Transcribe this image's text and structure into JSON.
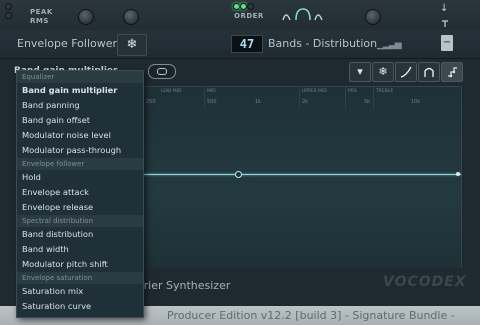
{
  "top": {
    "peak_label": "PEAK",
    "rms_label": "RMS",
    "order_label": "ORDER"
  },
  "panel": {
    "left_title": "Envelope Follower",
    "bands_value": "47",
    "right_title": "Bands - Distribution"
  },
  "graph": {
    "band_labels": [
      "LOW MID",
      "MID",
      "UPPER MID",
      "PRS",
      "TREBLE"
    ],
    "freq_labels": [
      "250",
      "500",
      "1k",
      "2k",
      "5k",
      "10k"
    ]
  },
  "menu": {
    "sections": [
      {
        "header": "Equalizer",
        "items": [
          "Band gain multiplier",
          "Band panning",
          "Band gain offset",
          "Modulator noise level",
          "Modulator pass-through"
        ]
      },
      {
        "header": "Envelope follower",
        "items": [
          "Hold",
          "Envelope attack",
          "Envelope release"
        ]
      },
      {
        "header": "Spectral distribution",
        "items": [
          "Band distribution",
          "Band width",
          "Modulator pitch shift"
        ]
      },
      {
        "header": "Envelope saturation",
        "items": [
          "Saturation mix",
          "Saturation curve"
        ]
      }
    ]
  },
  "bottom": {
    "synth_title": "Fourier Synthesizer",
    "logo": "VOCODEX",
    "status": "Producer Edition v12.2 [build 3] - Signature Bundle -"
  },
  "icons": {
    "freeze": "snowflake-icon",
    "envelope": "envelope-shape-icon",
    "filter": "filter-curve-icon",
    "bars": "bars-icon"
  },
  "colors": {
    "background": "#1e2a30",
    "envelope_line": "#8fd7dc",
    "lcd_text": "#a9dff2",
    "led_on": "#5ee08e"
  }
}
